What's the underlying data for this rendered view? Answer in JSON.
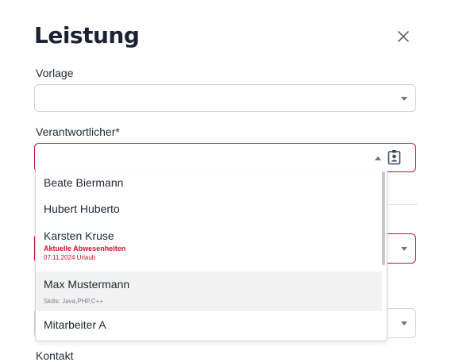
{
  "dialog": {
    "title": "Leistung",
    "close_icon": "close-icon"
  },
  "fields": {
    "vorlage": {
      "label": "Vorlage",
      "value": ""
    },
    "verantwortlicher": {
      "label": "Verantwortlicher",
      "required_mark": "*",
      "value": "",
      "contact_icon": "contact-card-icon"
    },
    "kontakt": {
      "label": "Kontakt"
    }
  },
  "dropdown": {
    "options": [
      {
        "name": "Beate Biermann"
      },
      {
        "name": "Hubert Huberto"
      },
      {
        "name": "Karsten Kruse",
        "absence_title": "Aktuelle Abwesenheiten",
        "absence_detail": "07.11.2024 Urlaub"
      },
      {
        "name": "Max Mustermann",
        "skills": "Skills: Java,PHP,C++"
      },
      {
        "name": "Mitarbeiter A"
      }
    ]
  },
  "colors": {
    "error": "#c8102e",
    "title": "#1a2234",
    "highlight": "#f2f2f2"
  }
}
